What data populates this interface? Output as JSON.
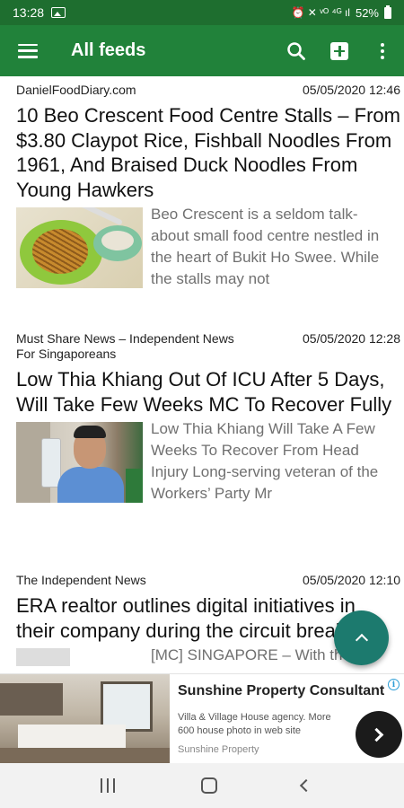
{
  "status_bar": {
    "time": "13:28",
    "icons": [
      "image-notification-icon",
      "alarm-icon",
      "mute-icon",
      "volte-icon",
      "4g-icon",
      "signal-icon",
      "battery-icon"
    ],
    "network_glyphs": "⏰ ✕ ᵛᴼ ⁴ᴳ ıl",
    "battery": "52%"
  },
  "app_bar": {
    "title": "All feeds",
    "icons": [
      "menu-icon",
      "search-icon",
      "add-feed-icon",
      "more-vert-icon"
    ]
  },
  "articles": [
    {
      "source": "DanielFoodDiary.com",
      "date": "05/05/2020 12:46",
      "headline": "10 Beo Crescent Food Centre Stalls – From $3.80 Claypot Rice, Fishball Noodles From 1961, And Braised Duck Noodles From Young Hawkers",
      "summary": "Beo Crescent is a seldom talk-about small food centre nestled in the heart of Bukit Ho Swee. While the stalls may not"
    },
    {
      "source": "Must Share News – Independent News For Singaporeans",
      "date": "05/05/2020 12:28",
      "headline": "Low Thia Khiang Out Of ICU After 5 Days, Will Take Few Weeks MC To Recover Fully",
      "summary": "Low Thia Khiang Will Take A Few Weeks To Recover From Head Injury Long-serving veteran of the Workers’ Party Mr"
    },
    {
      "source": "The Independent News",
      "date": "05/05/2020 12:10",
      "headline": "ERA realtor outlines digital initiatives in their company during the circuit breaker",
      "summary": "[MC] SINGAPORE – With the"
    }
  ],
  "fab": {
    "icon": "chevron-up-icon"
  },
  "ad": {
    "title": "Sunshine Property Consultant",
    "description": "Villa & Village House agency. More 600 house photo in web site",
    "advertiser": "Sunshine Property",
    "info_glyph": "i"
  },
  "nav_bar": {
    "icons": [
      "recents-icon",
      "home-icon",
      "back-icon"
    ]
  },
  "colors": {
    "status_bar": "#1e6e2f",
    "app_bar": "#21823a",
    "fab": "#1c7a6e",
    "summary_text": "#707070"
  }
}
